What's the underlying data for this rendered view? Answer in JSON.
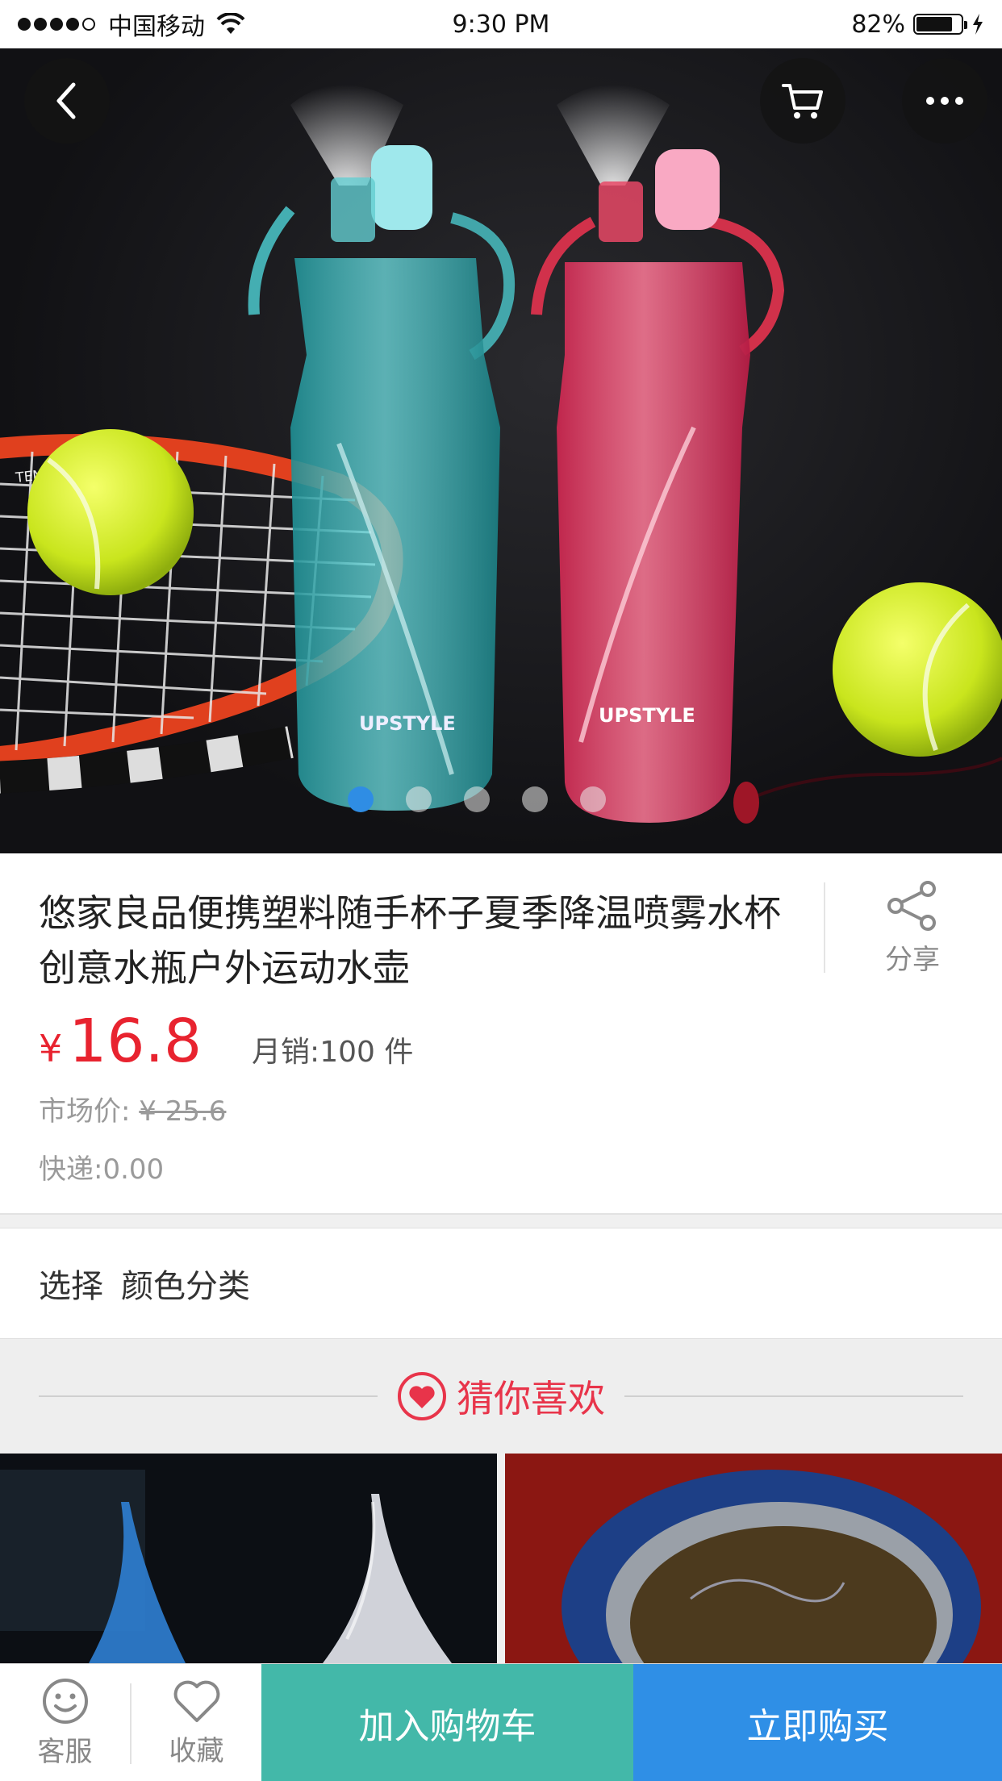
{
  "status_bar": {
    "carrier": "中国移动",
    "time": "9:30 PM",
    "battery": "82%",
    "battery_level": 0.82
  },
  "hero": {
    "image_description_icon": "product-photo-water-bottles",
    "bottle_brand": "UPSTYLE",
    "racket_text": "TENNIS RACKET",
    "carousel_total": 5,
    "carousel_active": 0
  },
  "product": {
    "title": "悠家良品便携塑料随手杯子夏季降温喷雾水杯创意水瓶户外运动水壶",
    "price_symbol": "¥",
    "price": "16.8",
    "sales_label": "月销:",
    "sales_value": "100 件",
    "market_label": "市场价:",
    "market_price": "¥ 25.6",
    "shipping_label": "快递:",
    "shipping_value": "0.00",
    "share_label": "分享"
  },
  "select": {
    "label": "选择",
    "value": "颜色分类"
  },
  "recommend": {
    "title": "猜你喜欢"
  },
  "bottom_bar": {
    "service_label": "客服",
    "favorite_label": "收藏",
    "add_cart_label": "加入购物车",
    "buy_now_label": "立即购买"
  },
  "colors": {
    "price_red": "#e8232f",
    "cart_green": "#43b8a9",
    "buy_blue": "#2f8fe6",
    "dot_active": "#2f8de4",
    "guess_red": "#e8344a"
  }
}
